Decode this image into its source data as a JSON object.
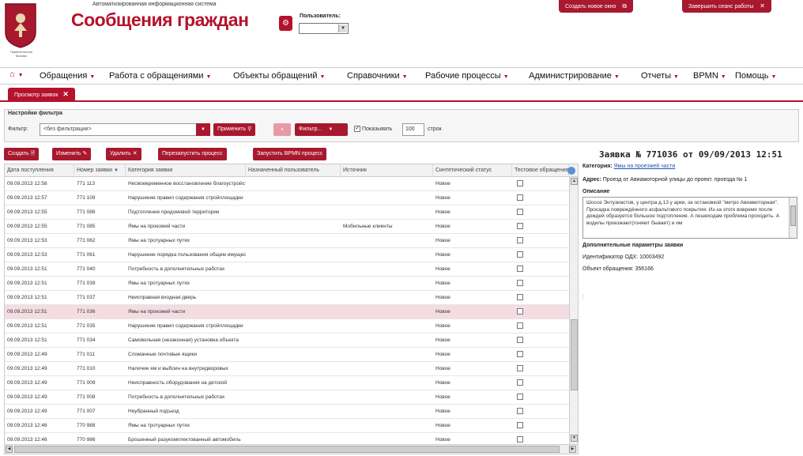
{
  "header": {
    "logo_caption": "Правительство Москвы",
    "subtitle": "Автоматизированная информационная система",
    "title": "Сообщения граждан",
    "user_label": "Пользователь:",
    "user_value": "",
    "btn_new_window": "Создать новое окно",
    "btn_logout": "Завершить сеанс работы"
  },
  "menu": [
    "Обращения",
    "Работа с обращениями",
    "Объекты обращений",
    "Справочники",
    "Рабочие процессы",
    "Администрирование",
    "Отчеты",
    "BPMN",
    "Помощь"
  ],
  "tab": {
    "label": "Просмотр заявок"
  },
  "filter": {
    "section_title": "Настройки фильтра",
    "label": "Фильтр:",
    "value": "<без фильтрации>",
    "apply": "Применить",
    "filter_btn": "Фильтр...",
    "show_label": "Показывать",
    "show_checked": true,
    "rows_count": "100",
    "rows_label": "строк"
  },
  "toolbar": {
    "create": "Создать",
    "edit": "Изменить",
    "delete": "Удалить",
    "restart": "Перезапустить процесс",
    "start_bpmn": "Запустить BPMN процесс"
  },
  "grid": {
    "columns": [
      "Дата поступления",
      "Номер заявки",
      "Категория заявки",
      "Назначенный пользователь",
      "Источник",
      "Синтетический статус",
      "Тестовое обращение"
    ],
    "rows": [
      [
        "09.09.2013 12:58",
        "771 113",
        "Несвоевременное восстановление благоустройства",
        "",
        "",
        "Новое"
      ],
      [
        "09.09.2013 12:57",
        "771 109",
        "Нарушение правил содержания стройплощадки",
        "",
        "",
        "Новое"
      ],
      [
        "09.09.2013 12:55",
        "771 088",
        "Подтопление придомовой территории",
        "",
        "",
        "Новое"
      ],
      [
        "09.09.2013 12:55",
        "771 085",
        "Ямы на проезжей части",
        "",
        "Мобильные клиенты",
        "Новое"
      ],
      [
        "09.09.2013 12:53",
        "771 062",
        "Ямы на тротуарных путях",
        "",
        "",
        "Новое"
      ],
      [
        "09.09.2013 12:53",
        "771 061",
        "Нарушение порядка пользования общим имуществом",
        "",
        "",
        "Новое"
      ],
      [
        "09.09.2013 12:51",
        "771 040",
        "Потребность в дополнительных работах",
        "",
        "",
        "Новое"
      ],
      [
        "09.09.2013 12:51",
        "771 039",
        "Ямы на тротуарных путях",
        "",
        "",
        "Новое"
      ],
      [
        "09.09.2013 12:51",
        "771 037",
        "Неисправная входная дверь",
        "",
        "",
        "Новое"
      ],
      [
        "09.09.2013 12:51",
        "771 036",
        "Ямы на проезжей части",
        "",
        "",
        "Новое"
      ],
      [
        "09.09.2013 12:51",
        "771 035",
        "Нарушение правил содержания стройплощадки",
        "",
        "",
        "Новое"
      ],
      [
        "09.09.2013 12:51",
        "771 034",
        "Самовольная (незаконная) установка объекта",
        "",
        "",
        "Новое"
      ],
      [
        "09.09.2013 12:49",
        "771 011",
        "Сломанные почтовые ящики",
        "",
        "",
        "Новое"
      ],
      [
        "09.09.2013 12:49",
        "771 010",
        "Наличие ям и выбоин на внутридворовых",
        "",
        "",
        "Новое"
      ],
      [
        "09.09.2013 12:49",
        "771 009",
        "Неисправность оборудования на детской",
        "",
        "",
        "Новое"
      ],
      [
        "09.09.2013 12:49",
        "771 008",
        "Потребность в дополнительных работах",
        "",
        "",
        "Новое"
      ],
      [
        "09.09.2013 12:49",
        "771 007",
        "Неубранный подъезд",
        "",
        "",
        "Новое"
      ],
      [
        "09.09.2013 12:46",
        "770 988",
        "Ямы на тротуарных путях",
        "",
        "",
        "Новое"
      ],
      [
        "09.09.2013 12:46",
        "770 986",
        "Брошенный разукомплектованный автомобиль",
        "",
        "",
        "Новое"
      ]
    ],
    "selected_index": 9
  },
  "detail": {
    "title": "Заявка № 771036 от 09/09/2013 12:51",
    "category_label": "Категория:",
    "category_value": "Ямы на проезжей части",
    "address_label": "Адрес:",
    "address_value": "Проезд от Авиамоторной улицы до проект. проезда № 1",
    "description_label": "Описание",
    "description_text": "Шоссе Энтузиастов, у центра д.13 у арки, за остановкой \"метро Авиамоторная\". Просадка повреждённого асфальтового покрытия. Из-за этого вовремя после дождей образуется большое подтопление. А пешеходам проблема проходить. А водилы проезжают(гоняют бывает) и им",
    "extra_label": "Дополнительные параметры заявки",
    "odh_id": "Идентификатор ОДХ: 10003492",
    "object": "Объект обращения: 356166"
  },
  "colors": {
    "accent": "#b5122b",
    "button": "#a8182e",
    "selected_row": "#f3dde2"
  }
}
